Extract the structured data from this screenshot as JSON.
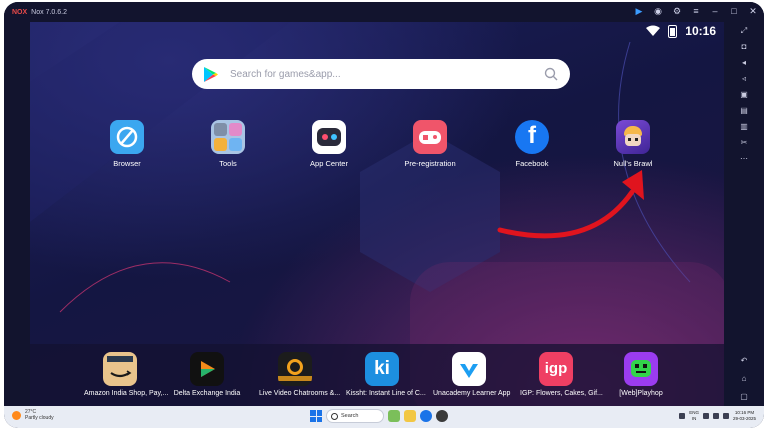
{
  "titlebar": {
    "logo": "NOX",
    "version": "Nox 7.0.6.2"
  },
  "status": {
    "time": "10:16"
  },
  "search": {
    "placeholder": "Search for games&app..."
  },
  "desktop_apps": [
    {
      "label": "Browser",
      "icon": "browser-icon",
      "color": "#3ba7f0"
    },
    {
      "label": "Tools",
      "icon": "tools-folder-icon",
      "color": "#7aa8d8"
    },
    {
      "label": "App Center",
      "icon": "app-center-icon",
      "color": "#ffffff"
    },
    {
      "label": "Pre-registration",
      "icon": "gamepad-icon",
      "color": "#f0556a"
    },
    {
      "label": "Facebook",
      "icon": "facebook-icon",
      "color": "#1877f2"
    },
    {
      "label": "Null's Brawl",
      "icon": "nulls-brawl-icon",
      "color": "#6a3fc8"
    }
  ],
  "dock_apps": [
    {
      "label": "Amazon India Shop, Pay,...",
      "icon": "amazon-icon",
      "color": "#e9c48c"
    },
    {
      "label": "Delta Exchange India",
      "icon": "delta-exchange-icon",
      "color": "#111111"
    },
    {
      "label": "Live Video Chatrooms &...",
      "icon": "eloelo-icon",
      "color": "#1c1c1c"
    },
    {
      "label": "Kissht: Instant Line of C...",
      "icon": "kissht-icon",
      "color": "#1d8fe0"
    },
    {
      "label": "Unacademy Learner App",
      "icon": "unacademy-icon",
      "color": "#ffffff"
    },
    {
      "label": "IGP: Flowers, Cakes, Gif...",
      "icon": "igp-icon",
      "color": "#ef3f63"
    },
    {
      "label": "[Web]Playhop",
      "icon": "playhop-icon",
      "color": "#9b3cf0"
    }
  ],
  "taskbar": {
    "weather_temp": "27°C",
    "weather_desc": "Partly cloudy",
    "search_label": "Search",
    "lang": "ENG",
    "lang2": "IN",
    "time": "10:16 PM",
    "date": "29-03-2025"
  },
  "colors": {
    "arrow": "#e0141e",
    "accent": "#3b9cff"
  }
}
